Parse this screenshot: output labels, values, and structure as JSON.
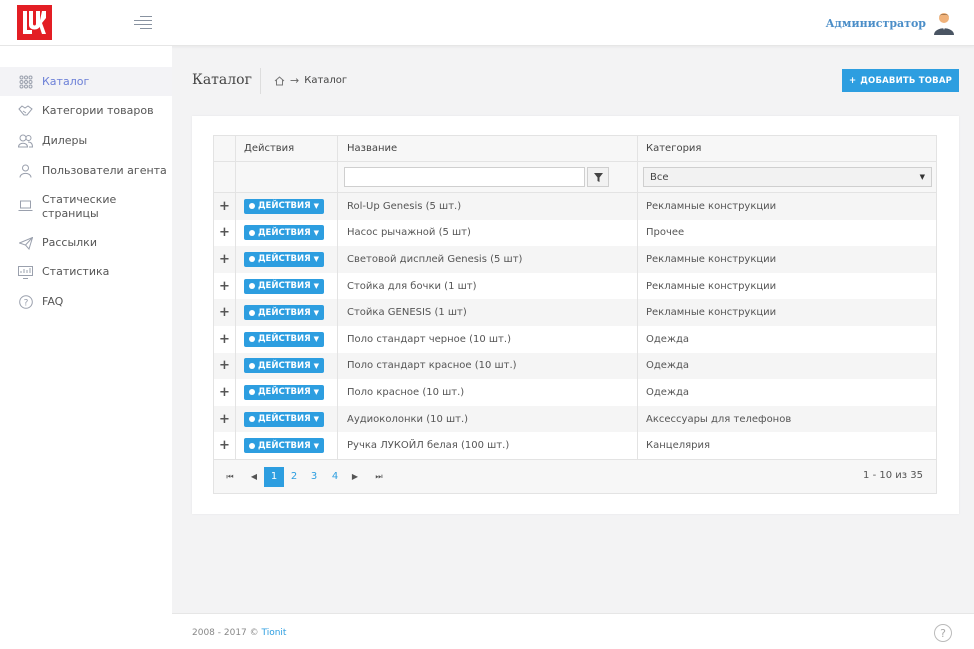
{
  "header": {
    "user_name": "Администратор"
  },
  "sidebar": {
    "items": [
      {
        "label": "Каталог",
        "icon": "grid-dots-icon"
      },
      {
        "label": "Категории товаров",
        "icon": "handshake-icon"
      },
      {
        "label": "Дилеры",
        "icon": "users-icon"
      },
      {
        "label": "Пользователи агента",
        "icon": "user-icon"
      },
      {
        "label": "Статические страницы",
        "icon": "laptop-icon"
      },
      {
        "label": "Рассылки",
        "icon": "paper-plane-icon"
      },
      {
        "label": "Статистика",
        "icon": "monitor-chart-icon"
      },
      {
        "label": "FAQ",
        "icon": "question-circle-icon"
      }
    ]
  },
  "page": {
    "title": "Каталог",
    "breadcrumb_current": "Каталог",
    "add_button_label": "ДОБАВИТЬ ТОВАР"
  },
  "grid": {
    "columns": [
      "Действия",
      "Название",
      "Категория"
    ],
    "filter": {
      "name_value": "",
      "category_selected": "Все"
    },
    "action_label": "ДЕЙСТВИЯ",
    "rows": [
      {
        "name": "Rol-Up Genesis (5 шт.)",
        "category": "Рекламные конструкции"
      },
      {
        "name": "Насос рычажной (5 шт)",
        "category": "Прочее"
      },
      {
        "name": "Световой дисплей Genesis (5 шт)",
        "category": "Рекламные конструкции"
      },
      {
        "name": "Стойка для бочки (1 шт)",
        "category": "Рекламные конструкции"
      },
      {
        "name": "Стойка GENESIS (1 шт)",
        "category": "Рекламные конструкции"
      },
      {
        "name": "Поло стандарт черное (10 шт.)",
        "category": "Одежда"
      },
      {
        "name": "Поло стандарт красное (10 шт.)",
        "category": "Одежда"
      },
      {
        "name": "Поло красное (10 шт.)",
        "category": "Одежда"
      },
      {
        "name": "Аудиоколонки (10 шт.)",
        "category": "Аксессуары для телефонов"
      },
      {
        "name": "Ручка ЛУКОЙЛ белая (100 шт.)",
        "category": "Канцелярия"
      }
    ],
    "pager": {
      "pages": [
        "1",
        "2",
        "3",
        "4"
      ],
      "current": "1",
      "info": "1 - 10 из 35"
    }
  },
  "footer": {
    "copyright": "2008 - 2017 © ",
    "brand": "Tionit"
  },
  "colors": {
    "accent": "#2d9ee0",
    "logo_red": "#e31e24",
    "active_nav": "#6b7fd7"
  }
}
